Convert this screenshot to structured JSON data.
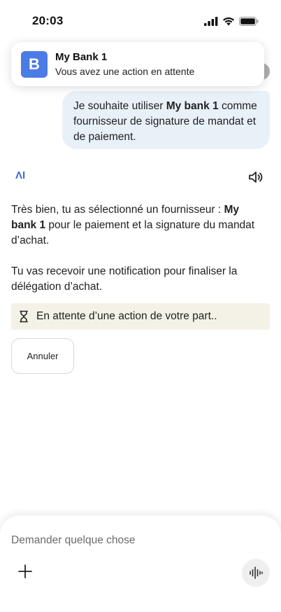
{
  "status_bar": {
    "time": "20:03",
    "icons": [
      "cellular-signal-icon",
      "wifi-icon",
      "battery-icon"
    ]
  },
  "notification": {
    "app_initial": "B",
    "title": "My Bank 1",
    "body": "Vous avez une action en attente",
    "logo_color": "#4b7be5"
  },
  "user_message": {
    "prefix": "Je souhaite utiliser ",
    "bold": "My bank 1",
    "suffix": " comme fournisseur de signature de mandat et de paiement."
  },
  "assistant": {
    "logo_text": "ΛI",
    "logo_color": "#3a6fd8",
    "paragraph1_prefix": "Très bien, tu as sélectionné un fournisseur : ",
    "paragraph1_bold": "My bank 1",
    "paragraph1_suffix": " pour le paiement et la signature du mandat d’achat.",
    "paragraph2": "Tu vas recevoir une notification pour finaliser la délégation d’achat.",
    "pending_text": "En attente d’une action de votre part..",
    "pending_bg": "#f4f2e6",
    "cancel_label": "Annuler"
  },
  "composer": {
    "placeholder": "Demander quelque chose"
  },
  "colors": {
    "user_bubble": "#e9f1f8",
    "voice_button_bg": "#efefef"
  }
}
